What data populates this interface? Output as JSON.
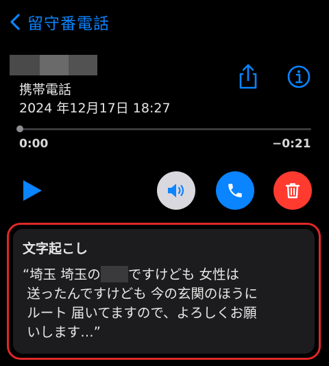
{
  "nav": {
    "back_title": "留守番電話"
  },
  "voicemail": {
    "caller_type": "携帯電話",
    "date_time": "2024 年12月17日 18:27",
    "elapsed": "0:00",
    "remaining": "−0:21",
    "progress": 0.0
  },
  "transcript": {
    "heading": "文字起こし",
    "line1_before": "“埼玉 埼玉の",
    "line1_after": "ですけども 女性は",
    "line2": " 送ったんですけども 今の玄関のほうに",
    "line3": " ルート 届いてますので、よろしくお願",
    "line4": " いします…”"
  },
  "icons": {
    "back": "chevron-left-icon",
    "share": "share-icon",
    "info": "info-icon",
    "play": "play-icon",
    "speaker": "speaker-icon",
    "call": "phone-icon",
    "delete": "trash-icon"
  },
  "colors": {
    "accent": "#0a84ff",
    "delete": "#ff3b30",
    "highlight_border": "#e02828"
  }
}
